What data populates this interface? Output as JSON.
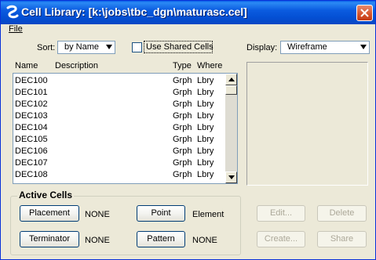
{
  "window": {
    "title": "Cell Library: [k:\\jobs\\tbc_dgn\\maturasc.cel]",
    "accent": "#0a5fe8"
  },
  "menu": {
    "file": "File"
  },
  "controls": {
    "sort_label": "Sort:",
    "sort_value": "by Name",
    "use_shared_label": "Use Shared Cells",
    "use_shared_checked": false,
    "display_label": "Display:",
    "display_value": "Wireframe"
  },
  "list": {
    "headers": {
      "name": "Name",
      "description": "Description",
      "type": "Type",
      "where": "Where"
    },
    "rows": [
      {
        "name": "DEC100",
        "description": "",
        "type": "Grph",
        "where": "Lbry"
      },
      {
        "name": "DEC101",
        "description": "",
        "type": "Grph",
        "where": "Lbry"
      },
      {
        "name": "DEC102",
        "description": "",
        "type": "Grph",
        "where": "Lbry"
      },
      {
        "name": "DEC103",
        "description": "",
        "type": "Grph",
        "where": "Lbry"
      },
      {
        "name": "DEC104",
        "description": "",
        "type": "Grph",
        "where": "Lbry"
      },
      {
        "name": "DEC105",
        "description": "",
        "type": "Grph",
        "where": "Lbry"
      },
      {
        "name": "DEC106",
        "description": "",
        "type": "Grph",
        "where": "Lbry"
      },
      {
        "name": "DEC107",
        "description": "",
        "type": "Grph",
        "where": "Lbry"
      },
      {
        "name": "DEC108",
        "description": "",
        "type": "Grph",
        "where": "Lbry"
      }
    ]
  },
  "active_cells": {
    "title": "Active Cells",
    "placement_button": "Placement",
    "placement_value": "NONE",
    "point_button": "Point",
    "point_value": "Element",
    "terminator_button": "Terminator",
    "terminator_value": "NONE",
    "pattern_button": "Pattern",
    "pattern_value": "NONE"
  },
  "actions": {
    "edit": "Edit...",
    "delete": "Delete",
    "create": "Create...",
    "share": "Share"
  }
}
